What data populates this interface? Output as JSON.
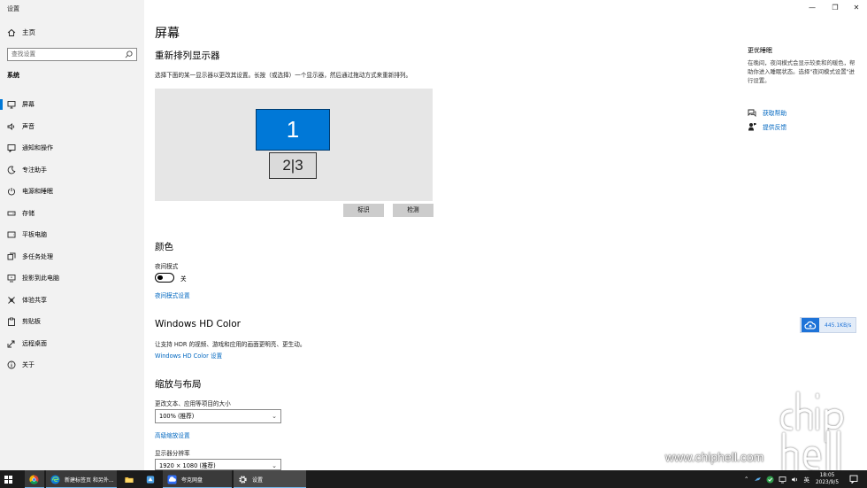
{
  "window": {
    "title": "设置",
    "minimize": "—",
    "maximize": "❐",
    "close": "✕"
  },
  "sidebar": {
    "home": "主页",
    "search_placeholder": "查找设置",
    "section": "系统",
    "items": [
      {
        "label": "屏幕",
        "icon": "monitor-icon",
        "active": true
      },
      {
        "label": "声音",
        "icon": "speaker-icon"
      },
      {
        "label": "通知和操作",
        "icon": "notification-icon"
      },
      {
        "label": "专注助手",
        "icon": "moon-icon"
      },
      {
        "label": "电源和睡眠",
        "icon": "power-icon"
      },
      {
        "label": "存储",
        "icon": "storage-icon"
      },
      {
        "label": "平板电脑",
        "icon": "tablet-icon"
      },
      {
        "label": "多任务处理",
        "icon": "multitask-icon"
      },
      {
        "label": "投影到此电脑",
        "icon": "project-icon"
      },
      {
        "label": "体验共享",
        "icon": "share-icon"
      },
      {
        "label": "剪贴板",
        "icon": "clipboard-icon"
      },
      {
        "label": "远程桌面",
        "icon": "remote-icon"
      },
      {
        "label": "关于",
        "icon": "info-icon"
      }
    ]
  },
  "main": {
    "title": "屏幕",
    "rearrange": {
      "heading": "重新排列显示器",
      "description": "选择下面的某一显示器以更改其设置。长按（或选择）一个显示器，然后通过拖动方式来重新排列。",
      "monitor1": "1",
      "monitor23": "2|3",
      "identify": "标识",
      "detect": "检测"
    },
    "color": {
      "heading": "颜色",
      "night_light_label": "夜间模式",
      "night_light_state": "关",
      "night_light_link": "夜间模式设置"
    },
    "hdr": {
      "heading": "Windows HD Color",
      "description": "让支持 HDR 的视频、游戏和应用的画面更明亮、更生动。",
      "link": "Windows HD Color 设置"
    },
    "scale": {
      "heading": "缩放与布局",
      "scale_label": "更改文本、应用等项目的大小",
      "scale_value": "100% (推荐)",
      "advanced_link": "高级缩放设置",
      "resolution_label": "显示器分辨率",
      "resolution_value": "1920 × 1080 (推荐)"
    }
  },
  "related": {
    "title": "更优睡眠",
    "text": "在晚间，夜间模式会显示较柔和的暖色，帮助你进入睡眠状态。选择\"夜间模式设置\"进行设置。",
    "get_help": "获取帮助",
    "feedback": "提供反馈"
  },
  "speed_widget": {
    "value": "445.1KB/s"
  },
  "watermark": {
    "url": "www.chiphell.com",
    "logo": "chip hell"
  },
  "taskbar": {
    "items": [
      {
        "label": "",
        "icon": "chrome-icon"
      },
      {
        "label": "新建标签页 和另外...",
        "icon": "edge-icon"
      },
      {
        "label": "",
        "icon": "folder-icon"
      },
      {
        "label": "",
        "icon": "app-icon"
      },
      {
        "label": "夸克网盘",
        "icon": "quark-cloud-icon"
      },
      {
        "label": "设置",
        "icon": "gear-icon"
      }
    ],
    "ime": "英",
    "time": "18:05",
    "date": "2023/9/5"
  }
}
